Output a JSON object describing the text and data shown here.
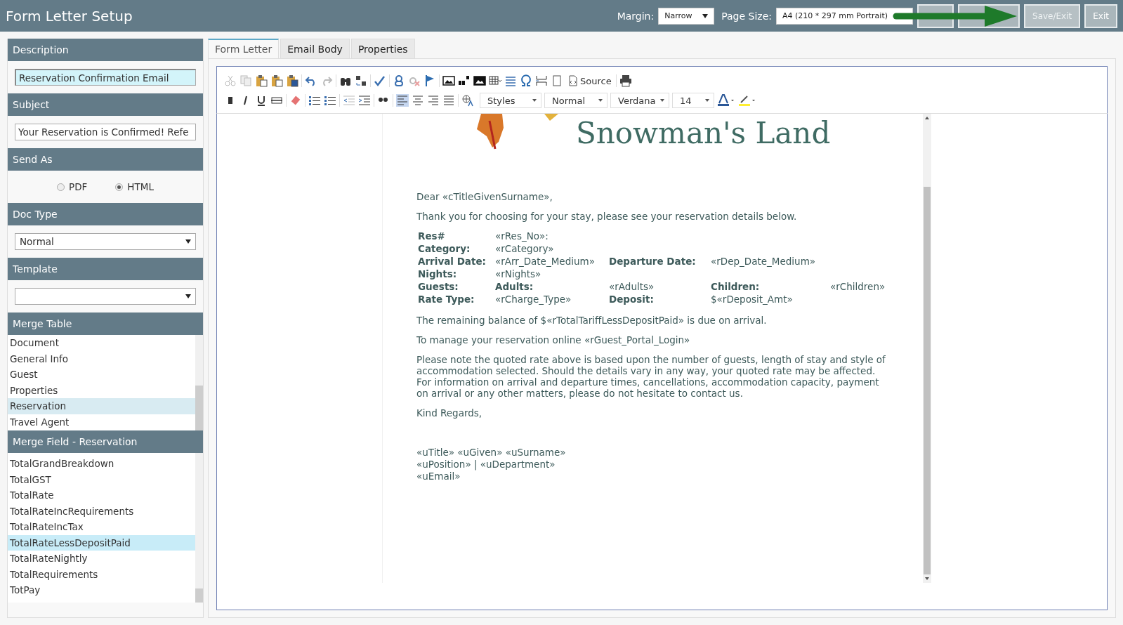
{
  "header": {
    "title": "Form Letter Setup",
    "margin_label": "Margin:",
    "margin_value": "Narrow",
    "page_size_label": "Page Size:",
    "page_size_value": "A4 (210 * 297 mm Portrait)",
    "buttons": [
      {
        "label": "Save/Exit",
        "disabled": true
      },
      {
        "label": "Exit",
        "disabled": false
      }
    ]
  },
  "sidebar": {
    "description": {
      "label": "Description",
      "value": "Reservation Confirmation Email"
    },
    "subject": {
      "label": "Subject",
      "value": "Your Reservation is Confirmed! Refe"
    },
    "send_as": {
      "label": "Send As",
      "options": [
        {
          "label": "PDF",
          "selected": false
        },
        {
          "label": "HTML",
          "selected": true
        }
      ]
    },
    "doc_type": {
      "label": "Doc Type",
      "value": "Normal"
    },
    "template": {
      "label": "Template"
    },
    "merge_table": {
      "label": "Merge Table",
      "items": [
        {
          "label": "Document",
          "selected": false
        },
        {
          "label": "General Info",
          "selected": false
        },
        {
          "label": "Guest",
          "selected": false
        },
        {
          "label": "Properties",
          "selected": false
        },
        {
          "label": "Reservation",
          "selected": true
        },
        {
          "label": "Travel Agent",
          "selected": false
        }
      ]
    },
    "merge_field": {
      "label": "Merge Field - Reservation",
      "items": [
        {
          "label": "TotalGrandBreakdown",
          "selected": false
        },
        {
          "label": "TotalGST",
          "selected": false
        },
        {
          "label": "TotalRate",
          "selected": false
        },
        {
          "label": "TotalRateIncRequirements",
          "selected": false
        },
        {
          "label": "TotalRateIncTax",
          "selected": false
        },
        {
          "label": "TotalRateLessDepositPaid",
          "selected": true
        },
        {
          "label": "TotalRateNightly",
          "selected": false
        },
        {
          "label": "TotalRequirements",
          "selected": false
        },
        {
          "label": "TotPay",
          "selected": false
        }
      ]
    }
  },
  "tabs": [
    {
      "label": "Form Letter",
      "selected": true
    },
    {
      "label": "Email Body",
      "selected": false
    },
    {
      "label": "Properties",
      "selected": false
    }
  ],
  "toolbar": {
    "source_label": "Source",
    "styles": "Styles",
    "format": "Normal",
    "font": "Verdana",
    "size": "14"
  },
  "document": {
    "heading": "Snowman's Land",
    "greeting": "Dear «cTitleGivenSurname»,",
    "intro": "Thank you for choosing  for your stay, please see your reservation details below.",
    "details": [
      [
        {
          "text": "Res#",
          "bold": true
        },
        {
          "text": "«rRes_No»:",
          "bold": false
        }
      ],
      [
        {
          "text": "Category:",
          "bold": true
        },
        {
          "text": "«rCategory»",
          "bold": false
        }
      ],
      [
        {
          "text": "Arrival Date:",
          "bold": true
        },
        {
          "text": "«rArr_Date_Medium»",
          "bold": false
        },
        {
          "text": "Departure Date:",
          "bold": true
        },
        {
          "text": "«rDep_Date_Medium»",
          "bold": false
        }
      ],
      [
        {
          "text": "Nights:",
          "bold": true
        },
        {
          "text": "«rNights»",
          "bold": false
        }
      ],
      [
        {
          "text": "Guests:",
          "bold": true
        },
        {
          "text": "Adults:",
          "bold": true
        },
        {
          "text": "«rAdults»",
          "bold": false
        },
        {
          "text": "Children:",
          "bold": true
        },
        {
          "text": "«rChildren»",
          "bold": false
        }
      ],
      [
        {
          "text": "Rate Type:",
          "bold": true
        },
        {
          "text": "«rCharge_Type»",
          "bold": false
        },
        {
          "text": "Deposit:",
          "bold": true
        },
        {
          "text": "$«rDeposit_Amt»",
          "bold": false
        }
      ]
    ],
    "paragraphs": [
      "The remaining balance of $«rTotalTariffLessDepositPaid» is due on arrival.",
      "To manage your reservation online «rGuest_Portal_Login»",
      "Please note the quoted rate above is based upon the number of guests, length of stay and style of accommodation selected. Should the details vary in any way, your quoted rate may be affected. For information on arrival and departure times, cancellations, accommodation capacity, payment on arrival or any other matters, please do not hesitate to contact us.",
      "Kind Regards,"
    ],
    "signature": [
      "«uTitle» «uGiven» «uSurname»",
      "«uPosition» | «uDepartment»",
      "«uEmail»"
    ]
  }
}
